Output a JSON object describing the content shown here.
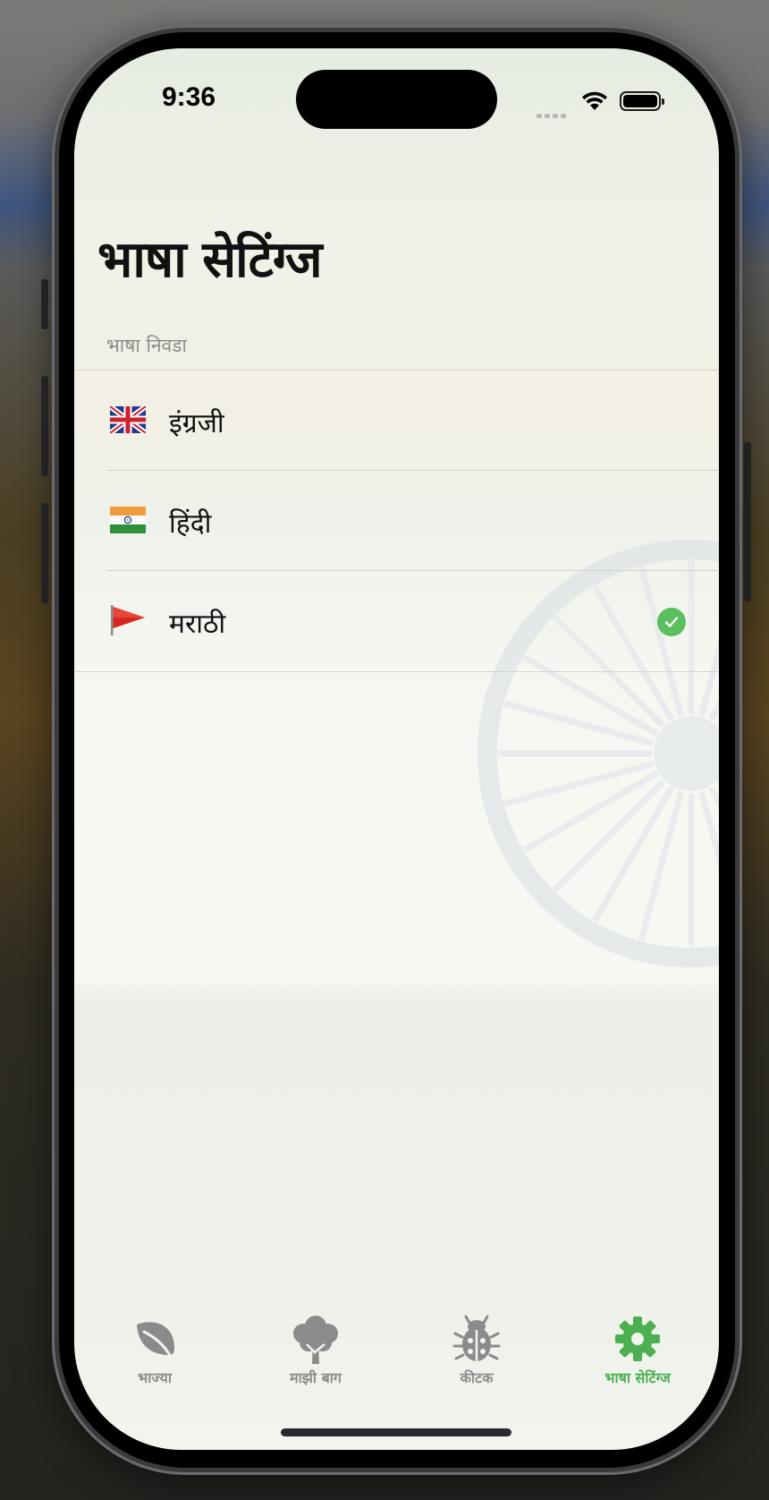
{
  "status_bar": {
    "time": "9:36"
  },
  "page": {
    "title": "भाषा सेटिंग्ज"
  },
  "section": {
    "header": "भाषा निवडा"
  },
  "languages": [
    {
      "label": "इंग्रजी",
      "flag": "uk-flag-icon",
      "selected": false
    },
    {
      "label": "हिंदी",
      "flag": "india-flag-icon",
      "selected": false
    },
    {
      "label": "मराठी",
      "flag": "red-triangular-flag-icon",
      "selected": true
    }
  ],
  "tabs": [
    {
      "label": "भाज्या",
      "icon": "leaf-icon",
      "active": false
    },
    {
      "label": "माझी बाग",
      "icon": "tree-icon",
      "active": false
    },
    {
      "label": "कीटक",
      "icon": "ladybug-icon",
      "active": false
    },
    {
      "label": "भाषा सेटिंग्ज",
      "icon": "gear-icon",
      "active": true
    }
  ],
  "colors": {
    "accent": "#4caf50",
    "inactive_tab": "#8b8b8b",
    "checkmark": "#5cbf5f"
  }
}
